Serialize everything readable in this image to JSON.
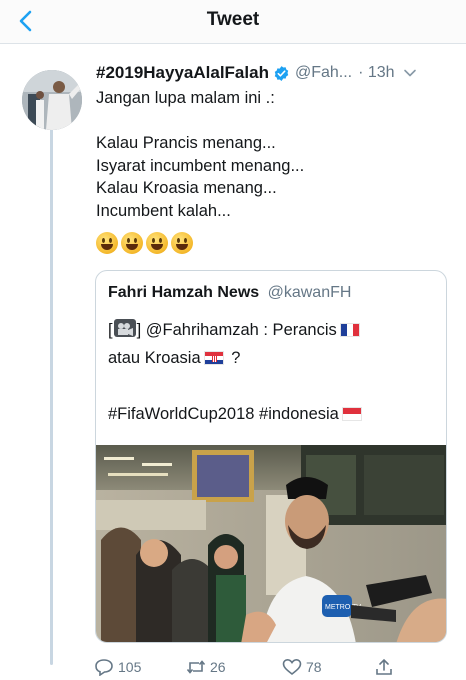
{
  "header": {
    "title": "Tweet"
  },
  "tweet": {
    "name": "#2019HayyaAlalFalah",
    "handle": "@Fah...",
    "time": "· 13h",
    "lines": [
      "Jangan lupa malam ini .:",
      "",
      "Kalau Prancis menang...",
      "Isyarat incumbent menang...",
      "Kalau Kroasia menang...",
      "Incumbent kalah..."
    ],
    "emoji_icons": [
      "grinning-face-icon",
      "grinning-face-icon",
      "grinning-face-icon",
      "grinning-face-icon"
    ]
  },
  "quote": {
    "name": "Fahri Hamzah News",
    "handle": "@kawanFH",
    "line1_prefix": "[",
    "line1_after_icon": "] @Fahrihamzah : Perancis",
    "line2": "atau Kroasia",
    "line2_suffix": " ?",
    "line4": "#FifaWorldCup2018 #indonesia",
    "photo_mic_label": "METRO TV"
  },
  "actions": {
    "reply_count": "105",
    "retweet_count": "26",
    "like_count": "78"
  },
  "colors": {
    "accent": "#1da1f2",
    "secondary_text": "#657786",
    "border": "#ccd6dd"
  }
}
